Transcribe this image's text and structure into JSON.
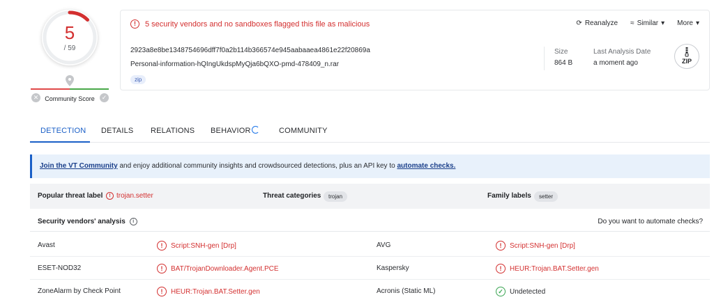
{
  "score": {
    "detections": "5",
    "total": "/ 59",
    "community_label": "Community Score"
  },
  "alert": {
    "text": "5 security vendors and no sandboxes flagged this file as malicious"
  },
  "actions": {
    "reanalyze": "Reanalyze",
    "similar": "Similar",
    "more": "More"
  },
  "file": {
    "hash": "2923a8e8be1348754696dff7f0a2b114b366574e945aabaaea4861e22f20869a",
    "name": "Personal-information-hQIngUkdspMyQja6bQXO-pmd-478409_n.rar",
    "tag": "zip",
    "size_label": "Size",
    "size_value": "864 B",
    "last_analysis_label": "Last Analysis Date",
    "last_analysis_value": "a moment ago",
    "type_badge": "ZIP"
  },
  "tabs": [
    {
      "label": "DETECTION"
    },
    {
      "label": "DETAILS"
    },
    {
      "label": "RELATIONS"
    },
    {
      "label": "BEHAVIOR"
    },
    {
      "label": "COMMUNITY"
    }
  ],
  "banner": {
    "link1": "Join the VT Community",
    "text": " and enjoy additional community insights and crowdsourced detections, plus an API key to ",
    "link2": "automate checks."
  },
  "threat": {
    "popular_label": "Popular threat label",
    "popular_value": "trojan.setter",
    "categories_label": "Threat categories",
    "categories_value": "trojan",
    "family_label": "Family labels",
    "family_value": "setter"
  },
  "vendors": {
    "title": "Security vendors' analysis",
    "automate": "Do you want to automate checks?",
    "rows": [
      {
        "left_name": "Avast",
        "left_result": "Script:SNH-gen [Drp]",
        "right_name": "AVG",
        "right_result": "Script:SNH-gen [Drp]"
      },
      {
        "left_name": "ESET-NOD32",
        "left_result": "BAT/TrojanDownloader.Agent.PCE",
        "right_name": "Kaspersky",
        "right_result": "HEUR:Trojan.BAT.Setter.gen"
      },
      {
        "left_name": "ZoneAlarm by Check Point",
        "left_result": "HEUR:Trojan.BAT.Setter.gen",
        "right_name": "Acronis (Static ML)",
        "right_result": "Undetected"
      }
    ]
  },
  "colors": {
    "malicious": "#d32f2f",
    "accent": "#1a5fc7",
    "clean": "#3aa552"
  }
}
